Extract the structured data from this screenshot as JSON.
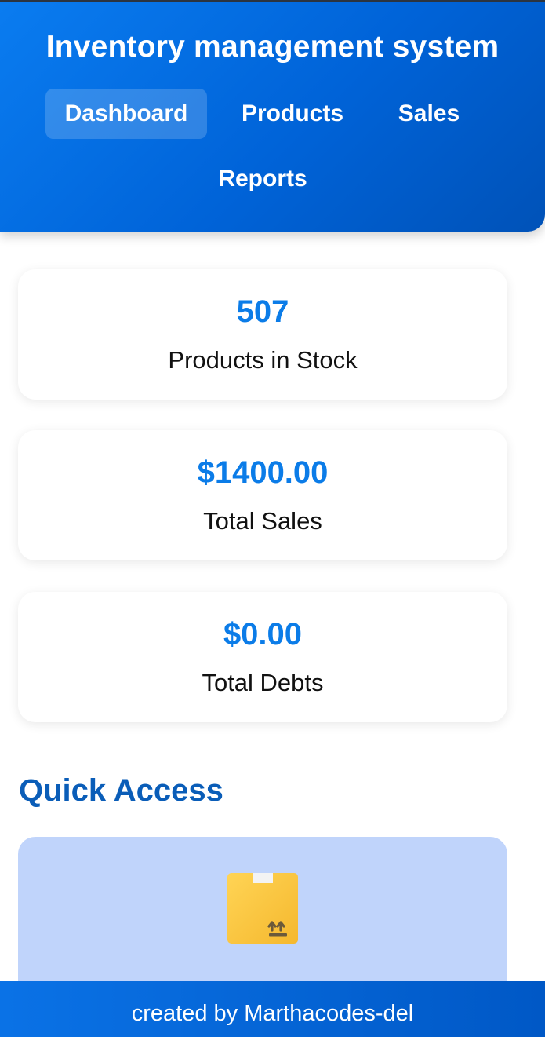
{
  "header": {
    "title": "Inventory management system",
    "nav": [
      {
        "label": "Dashboard",
        "active": true
      },
      {
        "label": "Products",
        "active": false
      },
      {
        "label": "Sales",
        "active": false
      },
      {
        "label": "Reports",
        "active": false
      }
    ]
  },
  "stats": [
    {
      "value": "507",
      "label": "Products in Stock"
    },
    {
      "value": "$1400.00",
      "label": "Total Sales"
    },
    {
      "value": "$0.00",
      "label": "Total Debts"
    }
  ],
  "quick_access": {
    "title": "Quick Access",
    "items": [
      {
        "icon": "package-icon"
      }
    ]
  },
  "footer": {
    "text": "created by Marthacodes-del"
  },
  "colors": {
    "header_blue": "#0a7cf0",
    "accent_value": "#0b7ce8",
    "section_title": "#0a5db8",
    "quick_card_bg": "#c0d4fb"
  }
}
